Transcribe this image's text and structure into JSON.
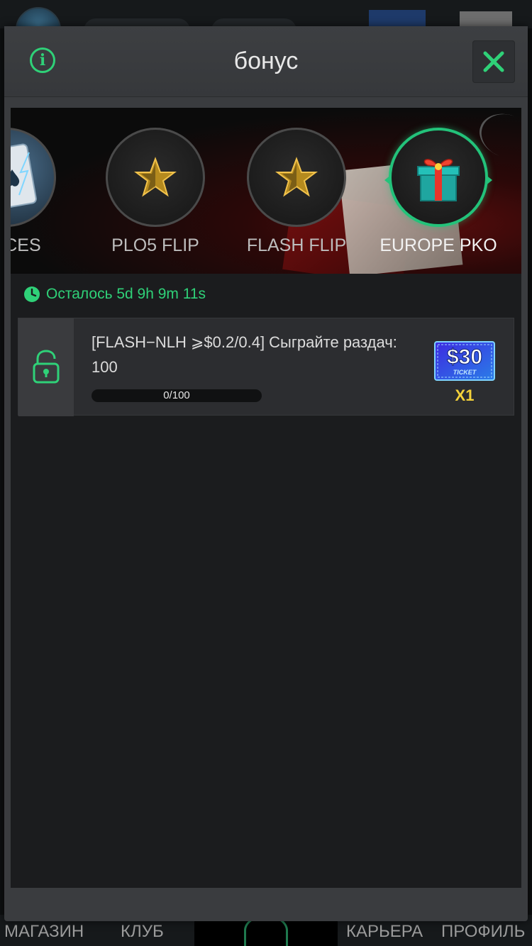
{
  "background": {
    "nav": [
      "МАГАЗИН",
      "КЛУБ",
      "КАРЬЕРА",
      "ПРОФИЛЬ"
    ]
  },
  "modal": {
    "title": "бонус",
    "info_icon": "info-icon",
    "close_icon": "close-icon"
  },
  "tabs": [
    {
      "label": "IE ACES",
      "icon": "aces-card-icon",
      "active": false
    },
    {
      "label": "PLO5 FLIP",
      "icon": "star-icon",
      "active": false
    },
    {
      "label": "FLASH FLIP",
      "icon": "star-icon",
      "active": false
    },
    {
      "label": "EUROPE PKO",
      "icon": "gift-icon",
      "active": true
    }
  ],
  "timer": {
    "icon": "clock-icon",
    "text": "Осталось 5d 9h 9m 11s"
  },
  "task": {
    "lock_icon": "unlock-icon",
    "description": "[FLASH−NLH ⩾$0.2/0.4] Сыграйте раздач: 100",
    "progress_text": "0/100",
    "progress_fraction": 0,
    "reward": {
      "icon": "ticket-icon",
      "amount": "$30",
      "label": "TICKET",
      "count": "X1"
    }
  },
  "colors": {
    "accent": "#2fd178",
    "reward_count": "#f5d23a"
  }
}
